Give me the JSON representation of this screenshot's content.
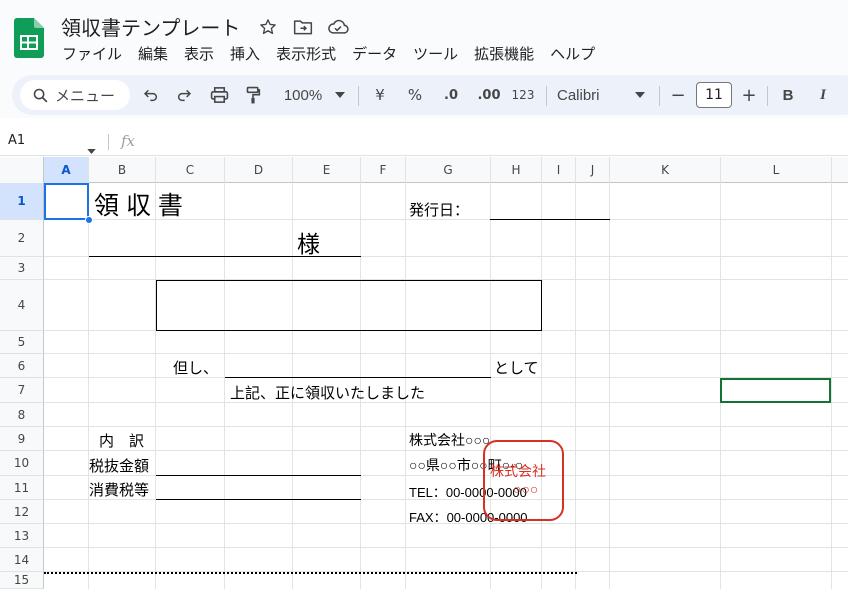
{
  "app": {
    "doc_title": "領収書テンプレート",
    "brand_color": "#0f9d58"
  },
  "menu": {
    "items": [
      "ファイル",
      "編集",
      "表示",
      "挿入",
      "表示形式",
      "データ",
      "ツール",
      "拡張機能",
      "ヘルプ"
    ]
  },
  "toolbar": {
    "search_label": "メニュー",
    "zoom": "100%",
    "currency": "¥",
    "percent": "%",
    "decrease_decimal": ".0",
    "increase_decimal": ".00",
    "number_format": "123",
    "font_name": "Calibri",
    "font_size": "11",
    "minus": "−",
    "plus": "+",
    "bold": "B",
    "italic": "I"
  },
  "formula_bar": {
    "name_box": "A1",
    "fx": "fx"
  },
  "grid": {
    "columns": [
      "A",
      "B",
      "C",
      "D",
      "E",
      "F",
      "G",
      "H",
      "I",
      "J",
      "K",
      "L"
    ],
    "rows": [
      "1",
      "2",
      "3",
      "4",
      "5",
      "6",
      "7",
      "8",
      "9",
      "10",
      "11",
      "12",
      "13",
      "14",
      "15"
    ],
    "selected_cell": "A1"
  },
  "receipt": {
    "title": "領 収 書",
    "issue_date_label": "発行日：",
    "honorific": "様",
    "proviso_label": "但し、",
    "proviso_suffix": "として",
    "received_text": "上記、正に領収いたしました",
    "breakdown_label": "内　訳",
    "pretax_label": "税抜金額",
    "tax_label": "消費税等",
    "company_name": "株式会社○○○",
    "address": "○○県○○市○○町○-○",
    "tel": "TEL：00-0000-0000",
    "fax": "FAX：00-0000-0000",
    "stamp_line1": "株式会社",
    "stamp_line2": "○○○",
    "stamp_color": "#d93025"
  }
}
